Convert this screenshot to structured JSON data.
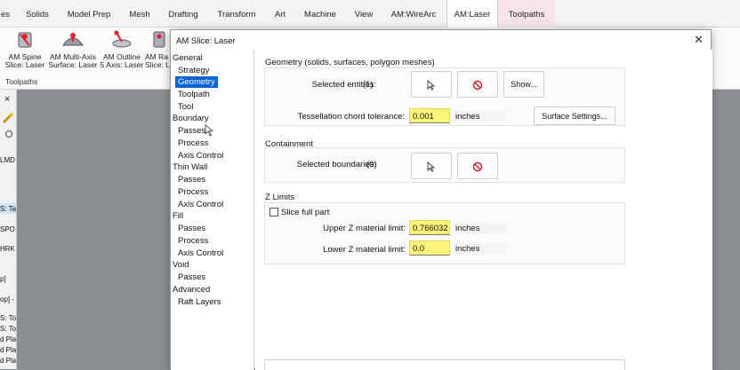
{
  "tabs": [
    "es",
    "Solids",
    "Model Prep",
    "Mesh",
    "Drafting",
    "Transform",
    "Art",
    "Machine",
    "View",
    "AM:WireArc",
    "AM:Laser",
    "Toolpaths"
  ],
  "active_tab": "AM:Laser",
  "ribbon": {
    "buttons": [
      {
        "line1": "AM Spine",
        "line2": "Slice: Laser"
      },
      {
        "line1": "AM Multi-Axis",
        "line2": "Surface: Laser"
      },
      {
        "line1": "AM Outline",
        "line2": "5 Axis: Laser"
      },
      {
        "line1": "AM Ra",
        "line2": "Slice: L"
      }
    ],
    "group_label": "Toolpaths"
  },
  "left_panel": {
    "close": "×",
    "lines": [
      "LMD",
      "S: Ta",
      "SPO",
      "HRK",
      "p]",
      "op] -",
      "S: To",
      "S: To",
      "d Pla",
      "d Pla",
      "d Pla"
    ]
  },
  "dialog": {
    "title": "AM Slice: Laser",
    "close": "✕",
    "nav": {
      "items": [
        {
          "label": "General",
          "level": 0
        },
        {
          "label": "Strategy",
          "level": 1
        },
        {
          "label": "Geometry",
          "level": 1,
          "selected": true
        },
        {
          "label": "Toolpath",
          "level": 1
        },
        {
          "label": "Tool",
          "level": 1
        },
        {
          "label": "Boundary",
          "level": 0
        },
        {
          "label": "Passes",
          "level": 1
        },
        {
          "label": "Process",
          "level": 1
        },
        {
          "label": "Axis Control",
          "level": 1
        },
        {
          "label": "Thin Wall",
          "level": 0
        },
        {
          "label": "Passes",
          "level": 1
        },
        {
          "label": "Process",
          "level": 1
        },
        {
          "label": "Axis Control",
          "level": 1
        },
        {
          "label": "Fill",
          "level": 0
        },
        {
          "label": "Passes",
          "level": 1
        },
        {
          "label": "Process",
          "level": 1
        },
        {
          "label": "Axis Control",
          "level": 1
        },
        {
          "label": "Void",
          "level": 0
        },
        {
          "label": "Passes",
          "level": 1
        },
        {
          "label": "Advanced",
          "level": 0
        },
        {
          "label": "Raft Layers",
          "level": 1
        }
      ]
    },
    "geometry": {
      "title": "Geometry (solids, surfaces, polygon meshes)",
      "selected_entities_label": "Selected entities:",
      "selected_entities_count": "(1)",
      "show_button": "Show...",
      "tessellation_label": "Tessellation chord tolerance:",
      "tessellation_value": "0.001",
      "tessellation_unit": "inches",
      "surface_settings_button": "Surface Settings..."
    },
    "containment": {
      "title": "Containment",
      "selected_boundaries_label": "Selected boundaries:",
      "selected_boundaries_count": "(0)"
    },
    "zlimits": {
      "title": "Z Limits",
      "slice_full_part_label": "Slice full part",
      "slice_full_part_checked": false,
      "upper_label": "Upper Z material limit:",
      "upper_value": "0.766032",
      "upper_unit": "inches",
      "lower_label": "Lower Z material limit:",
      "lower_value": "0.0",
      "lower_unit": "inches"
    }
  },
  "colors": {
    "accent_selected": "#0a64d8",
    "field_highlight": "#fbf37a",
    "toolpaths_tab": "#f6e4ea"
  }
}
